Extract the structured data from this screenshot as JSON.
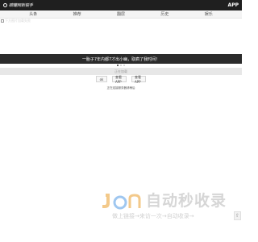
{
  "header": {
    "logo_text": "碳罐网新锐手",
    "app_label": "APP"
  },
  "nav": {
    "tabs": [
      {
        "label": "头条"
      },
      {
        "label": "推荐"
      },
      {
        "label": "翻层"
      },
      {
        "label": "历史"
      },
      {
        "label": "娱乐"
      }
    ]
  },
  "image_caption": "下方图片加载失败",
  "banner": {
    "text": "一胎子7年内都7才出小幽，取疯了我时间！",
    "slides": 3,
    "active_slide": 1
  },
  "strip": {
    "text": "正在加载"
  },
  "buttons": {
    "primary": "ok",
    "secondary": "查看APP",
    "tertiary": "查看APP"
  },
  "footer": {
    "note": "正在连接服务器请稍后"
  },
  "watermark": {
    "title": "自动秒收录",
    "subtitle": "做上链接→来访一次→自动收录→"
  },
  "back_top": {
    "symbol": "⇧"
  }
}
